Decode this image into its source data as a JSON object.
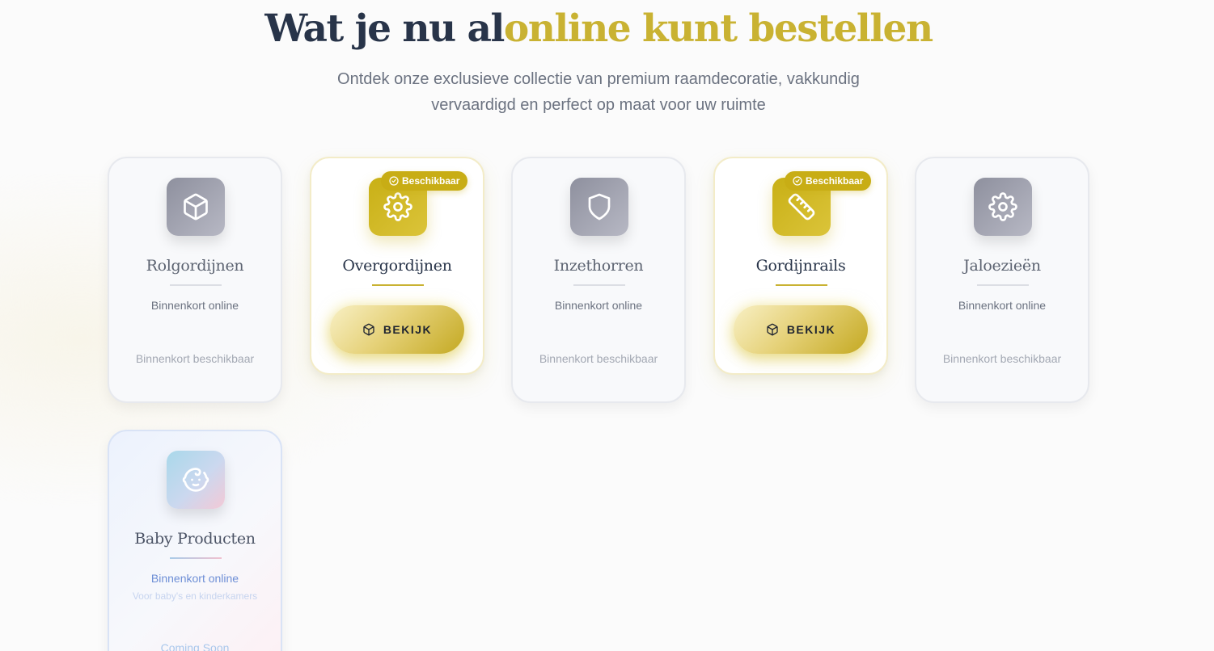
{
  "header": {
    "title_part1": "Wat je nu al",
    "title_part2": "online kunt bestellen",
    "subtitle": "Ontdek onze exclusieve collectie van premium raamdecoratie, vakkundig vervaardigd en perfect op maat voor uw ruimte"
  },
  "colors": {
    "accent_gold": "#c9b232",
    "heading_dark": "#283449"
  },
  "products": [
    {
      "title": "Rolgordijnen",
      "icon": "box-icon",
      "status": "Binnenkort online",
      "footnote": "Binnenkort beschikbaar",
      "available": false
    },
    {
      "title": "Overgordijnen",
      "icon": "gear-icon",
      "badge": "Beschikbaar",
      "button": "BEKIJK",
      "available": true
    },
    {
      "title": "Inzethorren",
      "icon": "shield-icon",
      "status": "Binnenkort online",
      "footnote": "Binnenkort beschikbaar",
      "available": false
    },
    {
      "title": "Gordijnrails",
      "icon": "ruler-icon",
      "badge": "Beschikbaar",
      "button": "BEKIJK",
      "available": true
    },
    {
      "title": "Jaloezieën",
      "icon": "gear-icon",
      "status": "Binnenkort online",
      "footnote": "Binnenkort beschikbaar",
      "available": false
    },
    {
      "title": "Baby Producten",
      "icon": "baby-icon",
      "status": "Binnenkort online",
      "description": "Voor baby's en kinderkamers",
      "footnote": "Coming Soon",
      "available": false
    }
  ]
}
